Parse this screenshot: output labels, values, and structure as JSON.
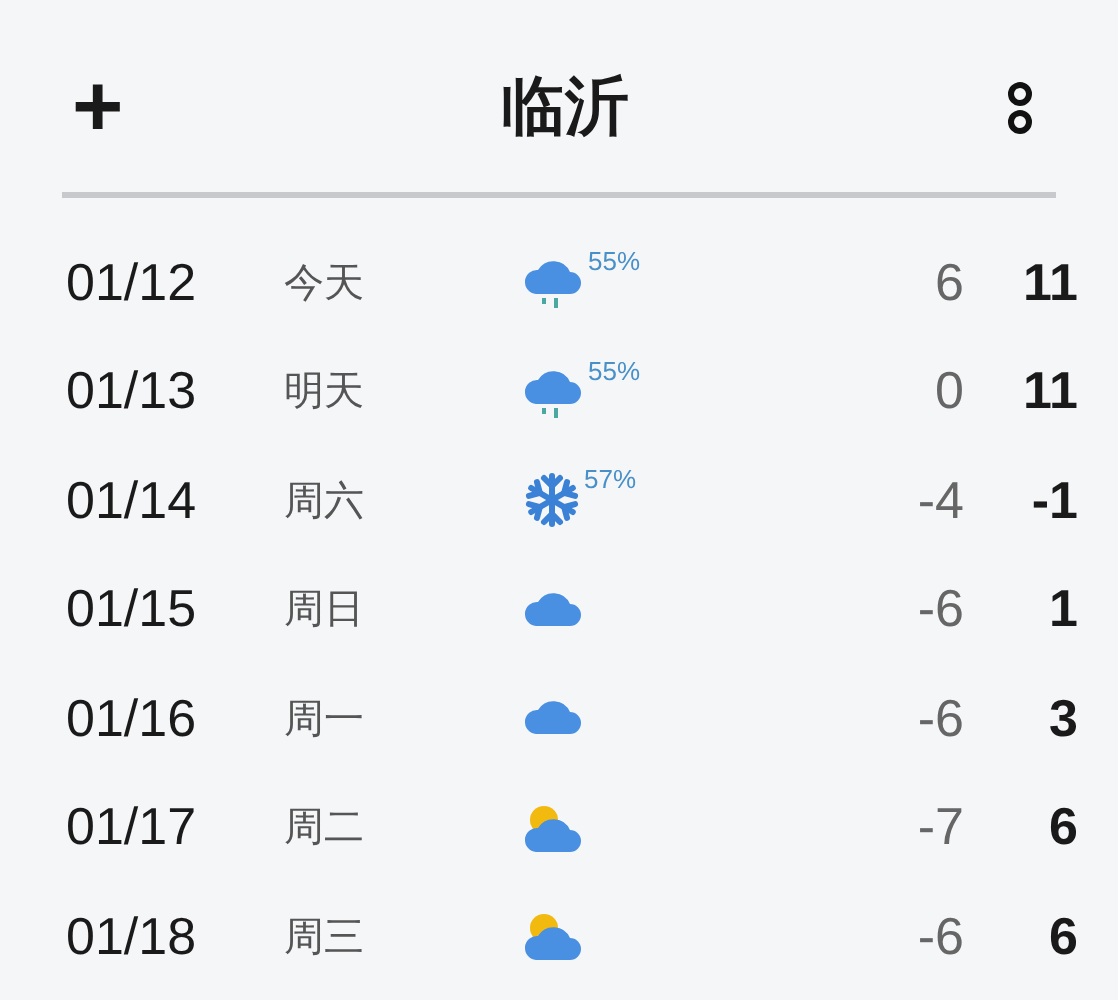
{
  "header": {
    "add": "+",
    "title": "临沂"
  },
  "days": [
    {
      "date": "01/12",
      "weekday": "今天",
      "kind": "rain",
      "precip": "55%",
      "low": "6",
      "high": "11"
    },
    {
      "date": "01/13",
      "weekday": "明天",
      "kind": "rain",
      "precip": "55%",
      "low": "0",
      "high": "11"
    },
    {
      "date": "01/14",
      "weekday": "周六",
      "kind": "snow",
      "precip": "57%",
      "low": "-4",
      "high": "-1"
    },
    {
      "date": "01/15",
      "weekday": "周日",
      "kind": "cloudy",
      "low": "-6",
      "high": "1"
    },
    {
      "date": "01/16",
      "weekday": "周一",
      "kind": "cloudy",
      "low": "-6",
      "high": "3"
    },
    {
      "date": "01/17",
      "weekday": "周二",
      "kind": "partly_cloudy",
      "low": "-7",
      "high": "6"
    },
    {
      "date": "01/18",
      "weekday": "周三",
      "kind": "partly_cloudy",
      "low": "-6",
      "high": "6"
    }
  ]
}
